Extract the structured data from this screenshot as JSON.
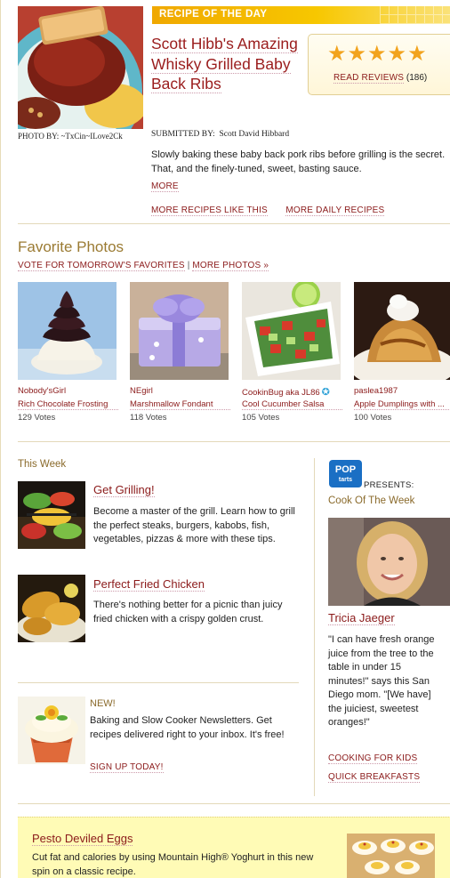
{
  "recipe_of_day": {
    "banner": "RECIPE OF THE DAY",
    "title": "Scott Hibb's Amazing Whisky Grilled Baby Back Ribs",
    "photo_credit": "PHOTO BY:  ~TxCin~ILove2Ck",
    "submitted_by_label": "SUBMITTED BY:",
    "submitted_by": "Scott David Hibbard",
    "rating": 5,
    "stars_text": "★★★★★",
    "read_reviews": "READ REVIEWS",
    "review_count": "(186)",
    "description": "Slowly baking these baby back pork ribs before grilling is the secret. That, and the finely-tuned, sweet, basting sauce.",
    "more": "MORE",
    "more_like_this": "MORE RECIPES LIKE THIS",
    "more_daily": "MORE DAILY RECIPES"
  },
  "favorite_photos": {
    "title": "Favorite Photos",
    "vote_link": "VOTE FOR TOMORROW'S FAVORITES",
    "separator": "|",
    "more_photos": "MORE PHOTOS »",
    "items": [
      {
        "user": "Nobody'sGirl",
        "name": "Rich Chocolate Frosting",
        "votes": "129 Votes"
      },
      {
        "user": "NEgirl",
        "name": "Marshmallow Fondant",
        "votes": "118 Votes"
      },
      {
        "user": "CookinBug aka JL86",
        "name": "Cool Cucumber Salsa",
        "votes": "105 Votes",
        "badge": "✪"
      },
      {
        "user": "paslea1987",
        "name": "Apple Dumplings with ...",
        "votes": "100 Votes"
      }
    ]
  },
  "this_week": {
    "title": "This Week",
    "features": [
      {
        "title": "Get Grilling!",
        "description": "Become a master of the grill. Learn how to grill the perfect steaks, burgers, kabobs, fish, vegetables, pizzas & more with these tips."
      },
      {
        "title": "Perfect Fried Chicken",
        "description": "There's nothing better for a picnic than juicy fried chicken with a crispy golden crust."
      }
    ],
    "newsletter": {
      "label": "NEW!",
      "description": "Baking and Slow Cooker Newsletters. Get recipes delivered right to your inbox. It's free!",
      "cta": "SIGN UP TODAY!"
    }
  },
  "cook_of_week": {
    "sponsor_presents": "PRESENTS:",
    "sponsor_logo_text": "Pop Tarts",
    "title": "Cook Of The Week",
    "name": "Tricia Jaeger",
    "quote": "\"I can have fresh orange juice from the tree to the table in under 15 minutes!\" says this San Diego mom. \"[We have] the juiciest, sweetest oranges!\"",
    "link_kids": "COOKING FOR KIDS",
    "link_breakfasts": "QUICK BREAKFASTS"
  },
  "promo": {
    "title": "Pesto Deviled Eggs",
    "description": "Cut fat and calories by using Mountain High® Yoghurt in this new spin on a classic recipe."
  },
  "colors": {
    "link": "#8b1a1a",
    "section_heading": "#9b7b33",
    "banner": "#f7c700",
    "star": "#f2a31d",
    "promo_bg": "#fffbb6"
  }
}
